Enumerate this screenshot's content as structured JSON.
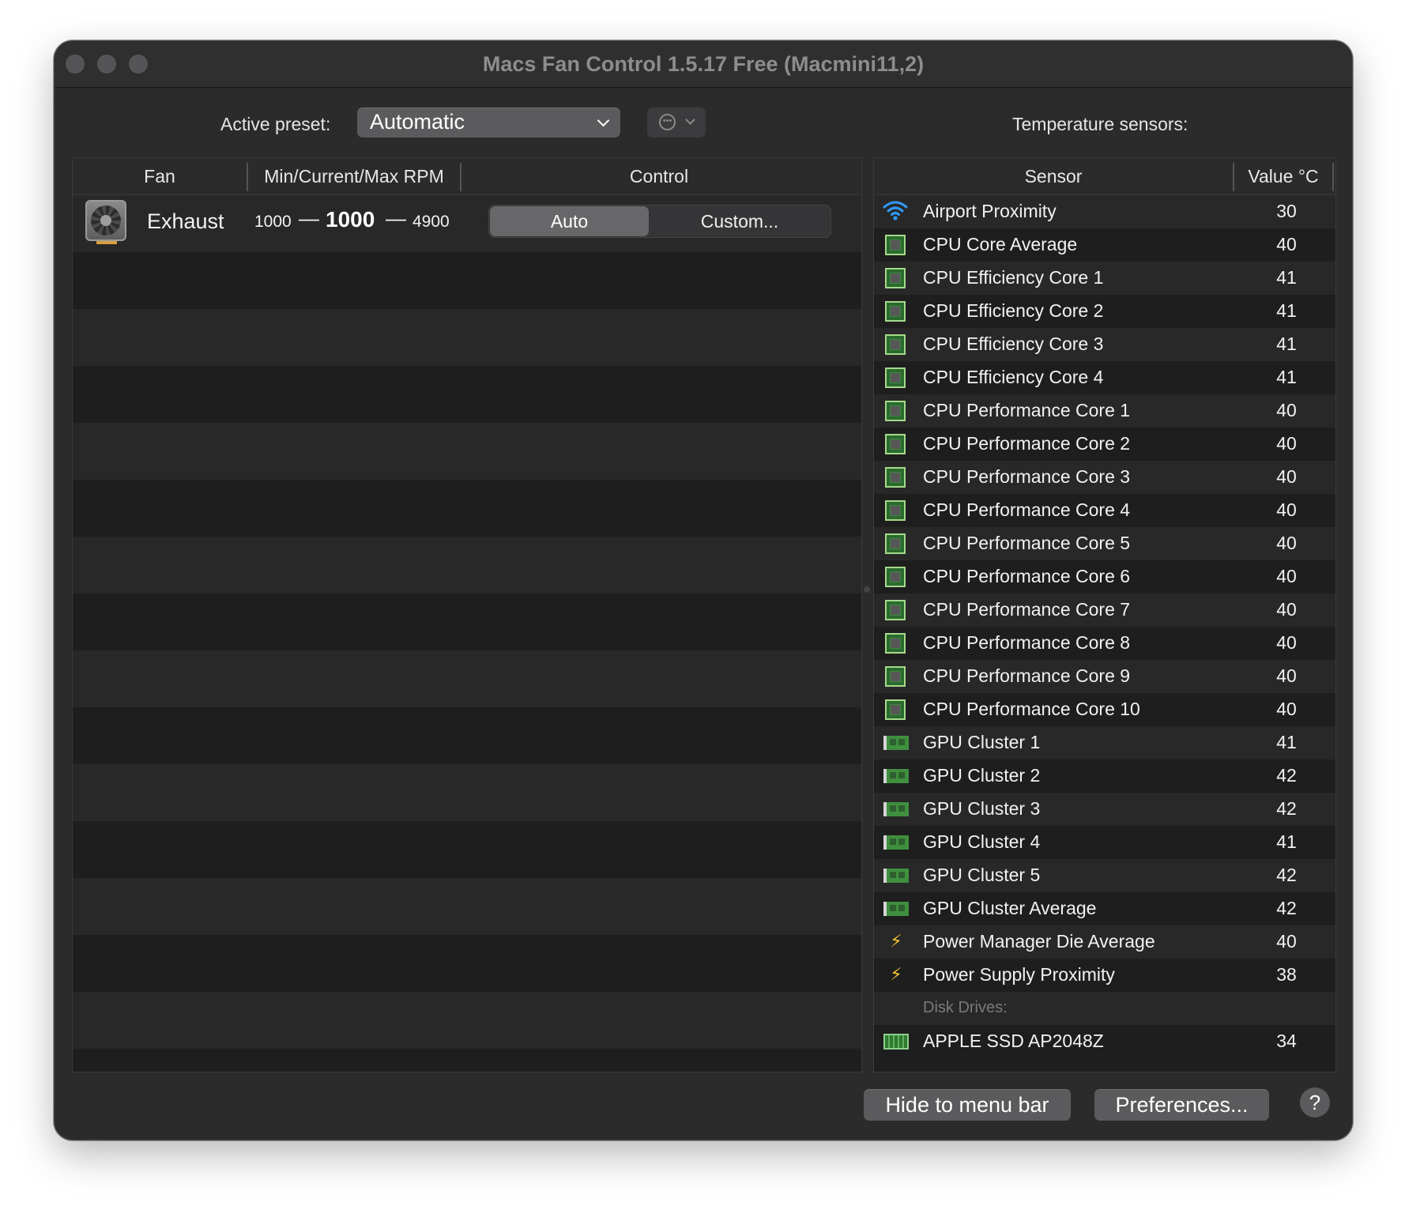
{
  "window": {
    "title": "Macs Fan Control 1.5.17 Free (Macmini11,2)"
  },
  "toolbar": {
    "preset_label": "Active preset:",
    "preset_value": "Automatic",
    "more_icon": "ellipsis-circle-icon",
    "temperature_label": "Temperature sensors:"
  },
  "fan_table": {
    "columns": [
      "Fan",
      "Min/Current/Max RPM",
      "Control"
    ],
    "fans": [
      {
        "name": "Exhaust",
        "icon": "fan-icon",
        "min_rpm": "1000",
        "current_rpm": "1000",
        "max_rpm": "4900",
        "dash": "—",
        "control_options": [
          "Auto",
          "Custom..."
        ],
        "selected_control": "Auto"
      }
    ]
  },
  "sensor_table": {
    "columns": [
      "Sensor",
      "Value °C"
    ],
    "rows": [
      {
        "icon": "wifi-icon",
        "name": "Airport Proximity",
        "value": "30"
      },
      {
        "icon": "cpu-icon",
        "name": "CPU Core Average",
        "value": "40"
      },
      {
        "icon": "cpu-icon",
        "name": "CPU Efficiency Core 1",
        "value": "41"
      },
      {
        "icon": "cpu-icon",
        "name": "CPU Efficiency Core 2",
        "value": "41"
      },
      {
        "icon": "cpu-icon",
        "name": "CPU Efficiency Core 3",
        "value": "41"
      },
      {
        "icon": "cpu-icon",
        "name": "CPU Efficiency Core 4",
        "value": "41"
      },
      {
        "icon": "cpu-icon",
        "name": "CPU Performance Core 1",
        "value": "40"
      },
      {
        "icon": "cpu-icon",
        "name": "CPU Performance Core 2",
        "value": "40"
      },
      {
        "icon": "cpu-icon",
        "name": "CPU Performance Core 3",
        "value": "40"
      },
      {
        "icon": "cpu-icon",
        "name": "CPU Performance Core 4",
        "value": "40"
      },
      {
        "icon": "cpu-icon",
        "name": "CPU Performance Core 5",
        "value": "40"
      },
      {
        "icon": "cpu-icon",
        "name": "CPU Performance Core 6",
        "value": "40"
      },
      {
        "icon": "cpu-icon",
        "name": "CPU Performance Core 7",
        "value": "40"
      },
      {
        "icon": "cpu-icon",
        "name": "CPU Performance Core 8",
        "value": "40"
      },
      {
        "icon": "cpu-icon",
        "name": "CPU Performance Core 9",
        "value": "40"
      },
      {
        "icon": "cpu-icon",
        "name": "CPU Performance Core 10",
        "value": "40"
      },
      {
        "icon": "gpu-icon",
        "name": "GPU Cluster 1",
        "value": "41"
      },
      {
        "icon": "gpu-icon",
        "name": "GPU Cluster 2",
        "value": "42"
      },
      {
        "icon": "gpu-icon",
        "name": "GPU Cluster 3",
        "value": "42"
      },
      {
        "icon": "gpu-icon",
        "name": "GPU Cluster 4",
        "value": "41"
      },
      {
        "icon": "gpu-icon",
        "name": "GPU Cluster 5",
        "value": "42"
      },
      {
        "icon": "gpu-icon",
        "name": "GPU Cluster Average",
        "value": "42"
      },
      {
        "icon": "bolt-icon",
        "name": "Power Manager Die Average",
        "value": "40"
      },
      {
        "icon": "bolt-icon",
        "name": "Power Supply Proximity",
        "value": "38"
      },
      {
        "group": "Disk Drives:"
      },
      {
        "icon": "ssd-icon",
        "name": "APPLE SSD AP2048Z",
        "value": "34"
      }
    ]
  },
  "footer": {
    "hide_label": "Hide to menu bar",
    "preferences_label": "Preferences...",
    "help_label": "?"
  },
  "colors": {
    "window_bg": "#2b2b2b",
    "table_bg": "#1e1e1e",
    "row_alt": "#282828",
    "button_bg": "#5b5b5d",
    "cpu_green": "#3b8a3e",
    "bolt_yellow": "#f4c430",
    "wifi_blue": "#2f9bff"
  }
}
